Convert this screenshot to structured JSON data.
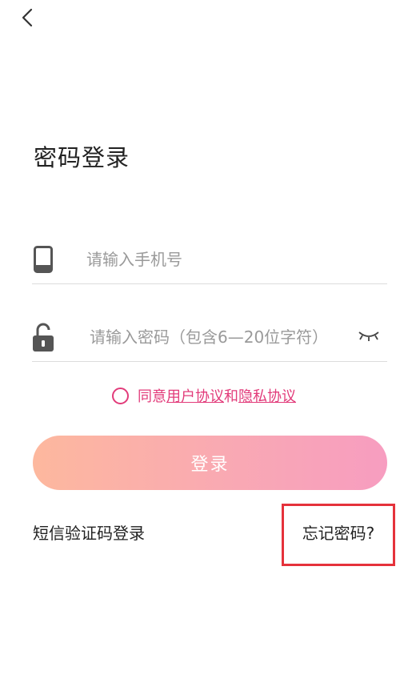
{
  "header": {
    "back_icon": "chevron-left-icon"
  },
  "title": "密码登录",
  "phone": {
    "icon": "phone-icon",
    "value": "",
    "placeholder": "请输入手机号"
  },
  "password": {
    "icon": "unlock-icon",
    "value": "",
    "placeholder": "请输入密码（包含6—20位字符）",
    "toggle_icon": "eye-closed-icon"
  },
  "agreement": {
    "prefix": "同意",
    "user_agreement": "用户协议",
    "conjunction": "和",
    "privacy_agreement": "隐私协议",
    "checked": false,
    "color": "#e23b7a"
  },
  "login_button": {
    "label": "登录"
  },
  "footer": {
    "sms_login": "短信验证码登录",
    "forgot_password": "忘记密码?",
    "highlight_color": "#e5323b"
  }
}
